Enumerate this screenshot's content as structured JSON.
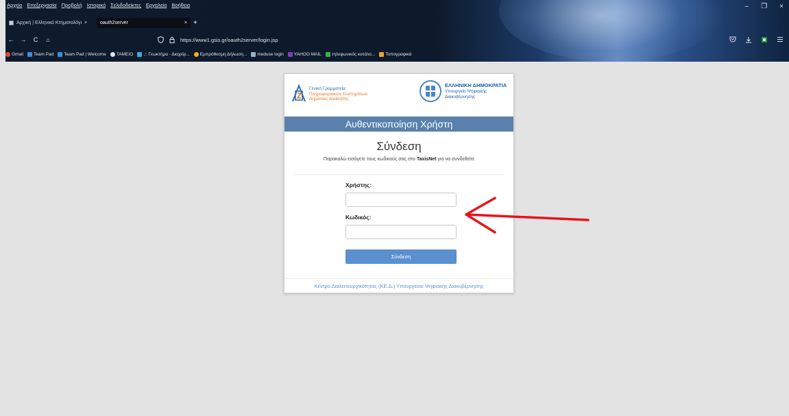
{
  "browser": {
    "menu": [
      "Αρχείο",
      "Επεξεργασία",
      "Προβολή",
      "Ιστορικό",
      "Σελιδοδείκτες",
      "Εργαλεία",
      "Βοήθεια"
    ],
    "tabs": [
      {
        "label": "Αρχική | Ελληνικό Κτηματολόγι",
        "close": "×"
      },
      {
        "label": "oauth2server",
        "close": "×"
      }
    ],
    "new_tab": "+",
    "nav": {
      "back": "←",
      "forward": "→",
      "reload": "C",
      "home": "⌂"
    },
    "url": "https://www1.gsis.gr/oauth2server/login.jsp",
    "shield_icon": "shield-icon",
    "lock_icon": "lock-icon",
    "window_controls": {
      "minimize": "–",
      "maximize": "❐",
      "close": "×"
    },
    "right_icons": [
      "pocket-icon",
      "download-icon",
      "extension-icon",
      "menu-icon"
    ],
    "bookmarks": [
      {
        "label": "Gmail",
        "color": "#e14a3b"
      },
      {
        "label": "Team Pad",
        "color": "#3d8fd6"
      },
      {
        "label": "Team Pad | Welcome",
        "color": "#3d8fd6"
      },
      {
        "label": "TAMEIO",
        "color": "#dfe5ee"
      },
      {
        "label": ".:: Γεωκτήμα - Διαχείρ...",
        "color": "#4aa3df"
      },
      {
        "label": "Εμπρόθεσμη Δήλωση...",
        "color": "#f2b01e"
      },
      {
        "label": "meduse login",
        "color": "#9ab0c8"
      },
      {
        "label": "YAHOO MAIL",
        "color": "#7b3fb8"
      },
      {
        "label": "τηλεφωνικός κατάλο...",
        "color": "#3fae4a"
      },
      {
        "label": "Τοπογραφικά",
        "color": "#e6a23c"
      }
    ]
  },
  "card": {
    "gsis": {
      "line1": "Γενική Γραμματεία",
      "line2": "Πληροφοριακών Συστημάτων",
      "line3": "Δημόσιας Διοίκησης"
    },
    "gr": {
      "title": "ΕΛΛΗΝΙΚΗ ΔΗΜΟΚΡΑΤΙΑ",
      "line1": "Υπουργείο Ψηφιακής",
      "line2": "Διακυβέρνησης"
    },
    "titlebar": "Αυθεντικοποίηση Χρήστη",
    "heading": "Σύνδεση",
    "sub_before": "Παρακαλώ εισάγετε τους κωδικούς σας στο ",
    "sub_bold": "TaxisNet",
    "sub_after": " για να συνδεθείτε",
    "username_label": "Χρήστης:",
    "password_label": "Κωδικός:",
    "username_value": "",
    "password_value": "",
    "submit": "Σύνδεση",
    "footer": "Κέντρο Διαλειτουργικότητας (ΚΕ.Δ.) Υπουργείου Ψηφιακής Διακυβέρνησης"
  },
  "annotation_color": "#e8131a"
}
